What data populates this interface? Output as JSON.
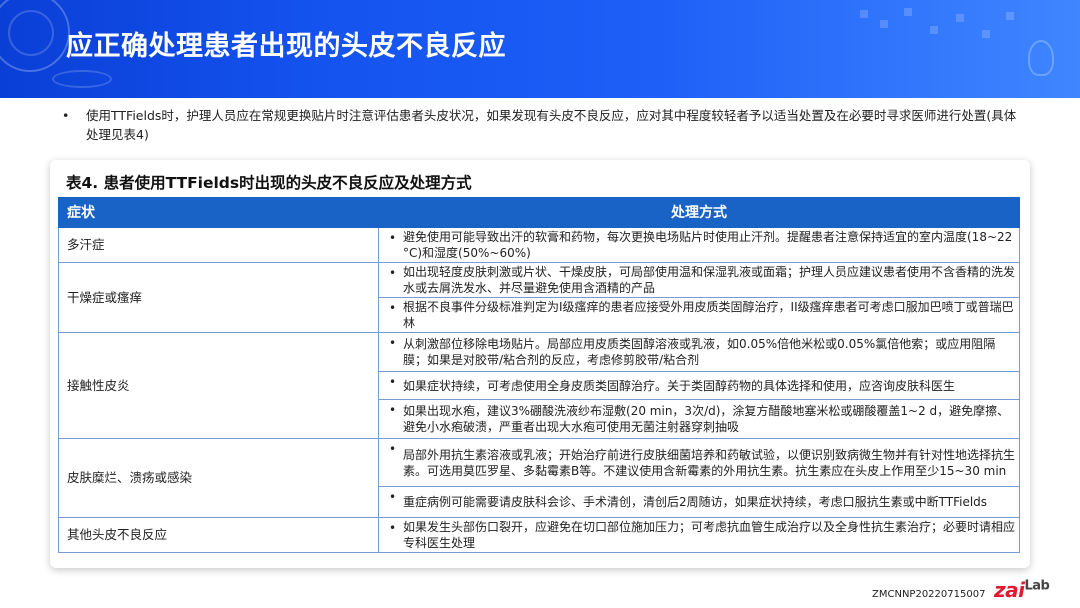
{
  "slide": {
    "title": "应正确处理患者出现的头皮不良反应",
    "intro_bullet": "•",
    "intro_text": "使用TTFields时，护理人员应在常规更换贴片时注意评估患者头皮状况，如果发现有头皮不良反应，应对其中程度较轻者予以适当处置及在必要时寻求医师进行处置(具体处理见表4)"
  },
  "table": {
    "title": "表4. 患者使用TTFields时出现的头皮不良反应及处理方式",
    "headers": {
      "symptom": "症状",
      "action": "处理方式"
    },
    "bullet": "•",
    "rows": [
      {
        "symptom": "多汗症",
        "actions": [
          "避免使用可能导致出汗的软膏和药物，每次更换电场贴片时使用止汗剂。提醒患者注意保持适宜的室内温度(18~22 °C)和湿度(50%~60%)"
        ]
      },
      {
        "symptom": "干燥症或瘙痒",
        "actions": [
          "如出现轻度皮肤刺激或片状、干燥皮肤，可局部使用温和保湿乳液或面霜；护理人员应建议患者使用不含香精的洗发水或去屑洗发水、并尽量避免使用含酒精的产品",
          "根据不良事件分级标准判定为I级瘙痒的患者应接受外用皮质类固醇治疗，II级瘙痒患者可考虑口服加巴喷丁或普瑞巴林"
        ]
      },
      {
        "symptom": "接触性皮炎",
        "actions": [
          "从刺激部位移除电场贴片。局部应用皮质类固醇溶液或乳液，如0.05%倍他米松或0.05%氯倍他索；或应用阻隔膜；如果是对胶带/粘合剂的反应，考虑修剪胶带/粘合剂",
          "如果症状持续，可考虑使用全身皮质类固醇治疗。关于类固醇药物的具体选择和使用，应咨询皮肤科医生",
          "如果出现水疱，建议3%硼酸洗液纱布湿敷(20 min，3次/d)，涂复方醋酸地塞米松或硼酸覆盖1~2 d，避免摩擦、避免小水疱破溃，严重者出现大水疱可使用无菌注射器穿刺抽吸"
        ]
      },
      {
        "symptom": "皮肤糜烂、溃疡或感染",
        "actions": [
          "局部外用抗生素溶液或乳液；开始治疗前进行皮肤细菌培养和药敏试验，以便识别致病微生物并有针对性地选择抗生素。可选用莫匹罗星、多黏霉素B等。不建议使用含新霉素的外用抗生素。抗生素应在头皮上作用至少15~30 min",
          "重症病例可能需要请皮肤科会诊、手术清创，清创后2周随访，如果症状持续，考虑口服抗生素或中断TTFields"
        ]
      },
      {
        "symptom": "其他头皮不良反应",
        "actions": [
          "如果发生头部伤口裂开，应避免在切口部位施加压力；可考虑抗血管生成治疗以及全身性抗生素治疗；必要时请相应专科医生处理"
        ]
      }
    ]
  },
  "footer": {
    "code": "ZMCNNP20220715007",
    "logo_main": "zai",
    "logo_sub": "Lab"
  },
  "colors": {
    "banner": "#1553ef",
    "table_header": "#1a63c6",
    "logo": "#e11931"
  }
}
